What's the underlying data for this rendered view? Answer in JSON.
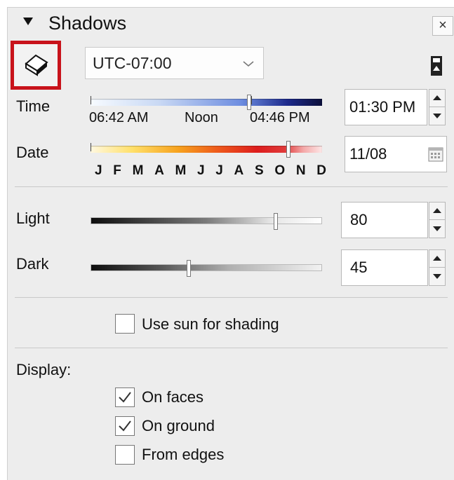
{
  "panel": {
    "title": "Shadows",
    "close_label": "×"
  },
  "toolbar": {
    "timezone": "UTC-07:00"
  },
  "time": {
    "label": "Time",
    "sunrise": "06:42 AM",
    "noon": "Noon",
    "sunset": "04:46 PM",
    "value": "01:30 PM",
    "slider_fraction": 0.71
  },
  "date": {
    "label": "Date",
    "months": [
      "J",
      "F",
      "M",
      "A",
      "M",
      "J",
      "J",
      "A",
      "S",
      "O",
      "N",
      "D"
    ],
    "value": "11/08",
    "slider_fraction": 0.87
  },
  "light": {
    "label": "Light",
    "value": "80",
    "slider_fraction": 0.8
  },
  "dark": {
    "label": "Dark",
    "value": "45",
    "slider_fraction": 0.45
  },
  "use_sun": {
    "label": "Use sun for shading",
    "checked": false
  },
  "display": {
    "label": "Display:",
    "options": [
      {
        "label": "On faces",
        "checked": true
      },
      {
        "label": "On ground",
        "checked": true
      },
      {
        "label": "From edges",
        "checked": false
      }
    ]
  },
  "colors": {
    "highlight_border": "#c8131b",
    "panel_bg": "#ededed"
  },
  "icons": {
    "collapse": "triangle-down-icon",
    "close": "close-icon",
    "shadow_toggle": "shadow-box-icon",
    "dropdown": "chevron-down-icon",
    "settings": "panel-settings-icon",
    "calendar": "calendar-icon"
  }
}
